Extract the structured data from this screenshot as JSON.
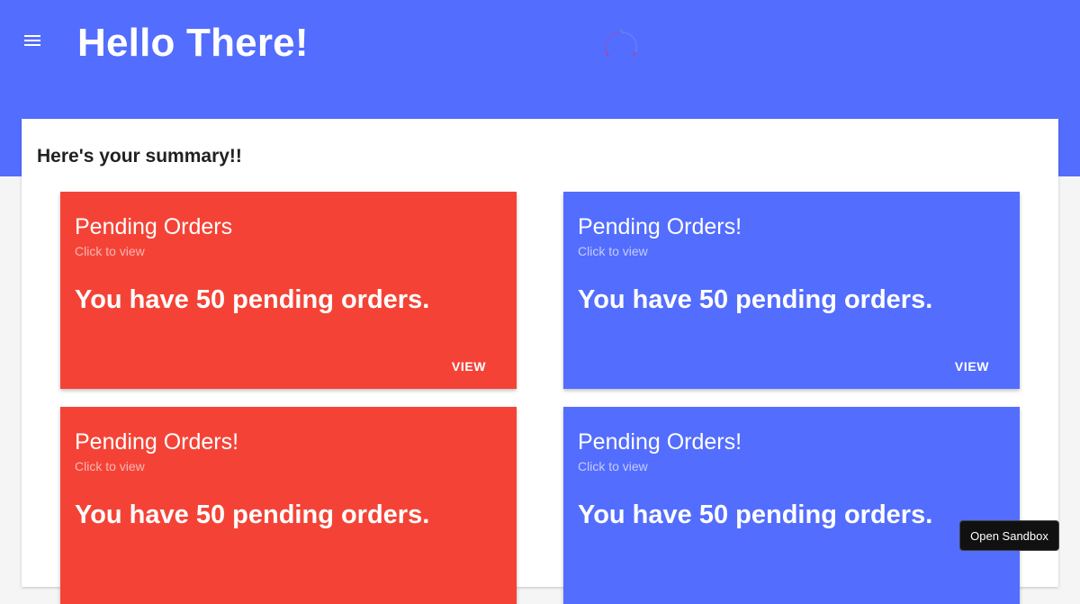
{
  "header": {
    "title": "Hello There!",
    "menu_icon": "hamburger-menu-icon",
    "loading_icon": "loading-spinner-icon"
  },
  "summary": {
    "heading": "Here's your summary!!",
    "cards": [
      {
        "title": "Pending Orders",
        "subtitle": "Click to view",
        "body": "You have 50 pending orders.",
        "action": "VIEW",
        "color": "#f44336"
      },
      {
        "title": "Pending Orders!",
        "subtitle": "Click to view",
        "body": "You have 50 pending orders.",
        "action": "VIEW",
        "color": "#536dfe"
      },
      {
        "title": "Pending Orders!",
        "subtitle": "Click to view",
        "body": "You have 50 pending orders.",
        "color": "#f44336"
      },
      {
        "title": "Pending Orders!",
        "subtitle": "Click to view",
        "body": "You have 50 pending orders.",
        "color": "#536dfe"
      }
    ]
  },
  "sandbox_button": "Open Sandbox",
  "colors": {
    "primary": "#536dfe",
    "accent_red": "#f44336",
    "background": "#f5f5f5"
  }
}
